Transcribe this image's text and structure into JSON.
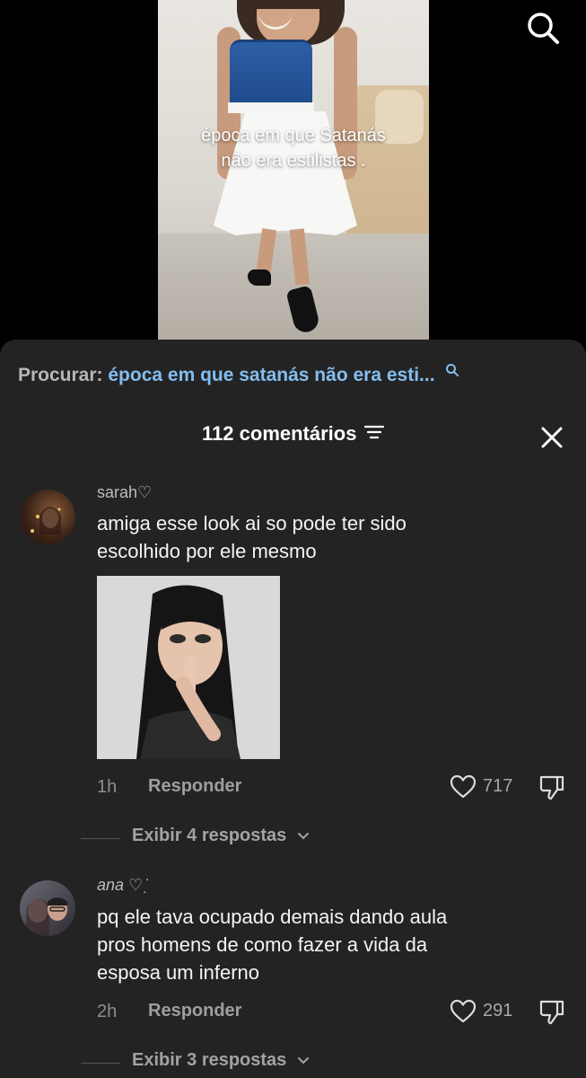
{
  "video": {
    "caption_line1": "época em que Satanás",
    "caption_line2": "não era estilistas ."
  },
  "search": {
    "label": "Procurar:",
    "query": "época em que satanás não era esti..."
  },
  "comments_panel": {
    "count_label": "112 comentários"
  },
  "comments": [
    {
      "username": "sarah♡",
      "text_line1": "amiga esse look ai so pode ter sido",
      "text_line2": "escolhido por ele mesmo",
      "time": "1h",
      "reply_label": "Responder",
      "likes": "717",
      "view_replies": "Exibir 4 respostas"
    },
    {
      "username": "ana ♡ ̇ ̣",
      "text_line1": "pq ele tava ocupado demais dando aula",
      "text_line2": "pros homens de como fazer a vida da",
      "text_line3": "esposa um inferno",
      "time": "2h",
      "reply_label": "Responder",
      "likes": "291",
      "view_replies": "Exibir 3 respostas"
    }
  ],
  "colors": {
    "sheet_background": "#232323",
    "search_query": "#84bdf0",
    "text_primary": "#f4f4f4",
    "text_muted": "#8f8f8f"
  },
  "icons": [
    "search-icon",
    "sort-icon",
    "close-icon",
    "heart-icon",
    "dislike-icon",
    "chevron-down-icon"
  ]
}
